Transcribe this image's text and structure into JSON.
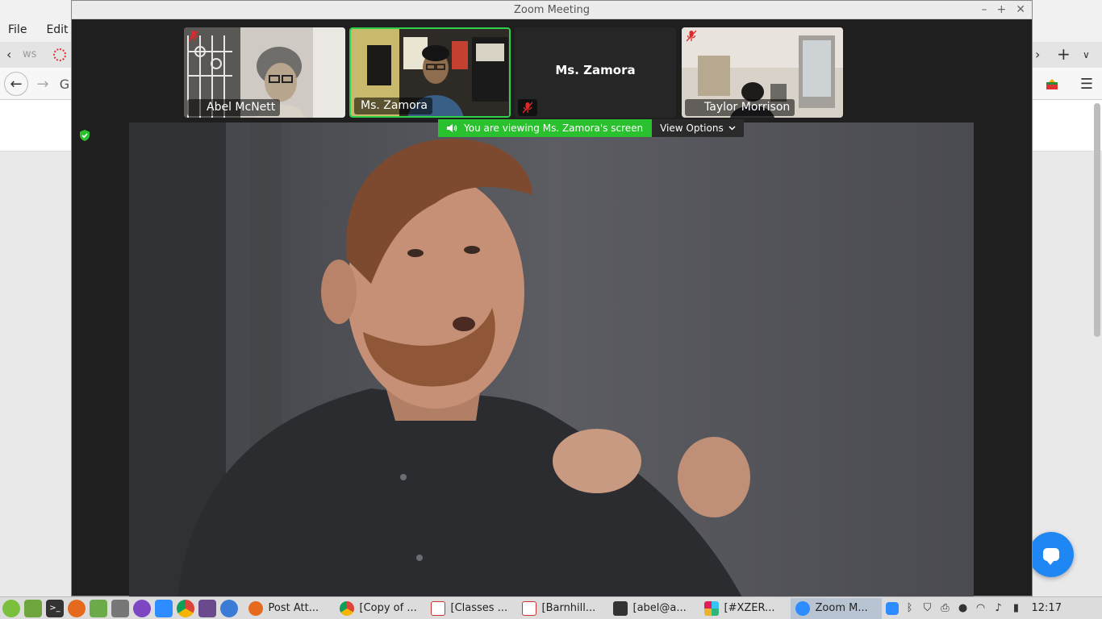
{
  "browser": {
    "menu": [
      "File",
      "Edit"
    ],
    "tab_partial_text": "ws"
  },
  "zoom": {
    "window_title": "Zoom Meeting",
    "participants": [
      {
        "name": "Abel McNett",
        "muted": true
      },
      {
        "name": "Ms. Zamora",
        "muted": false,
        "active": true
      },
      {
        "name": "Ms. Zamora",
        "muted": true,
        "video": false
      },
      {
        "name": "Taylor Morrison",
        "muted": true
      }
    ],
    "share_banner": "You are viewing Ms. Zamora's screen",
    "view_options_label": "View Options"
  },
  "taskbar": {
    "tasks": [
      {
        "label": "Post Att...",
        "icon": "firefox-icon"
      },
      {
        "label": "[Copy of ...",
        "icon": "chrome-icon"
      },
      {
        "label": "[Classes ...",
        "icon": "chart-app-icon"
      },
      {
        "label": "[Barnhill...",
        "icon": "chart-app-icon"
      },
      {
        "label": "[abel@a...",
        "icon": "terminal-icon"
      },
      {
        "label": "[#XZER...",
        "icon": "slack-icon"
      },
      {
        "label": "Zoom M...",
        "icon": "zoom-icon",
        "active": true
      }
    ],
    "clock": "12:17"
  },
  "colors": {
    "accent_green": "#2ac12e",
    "zoom_blue": "#2d8cff"
  }
}
